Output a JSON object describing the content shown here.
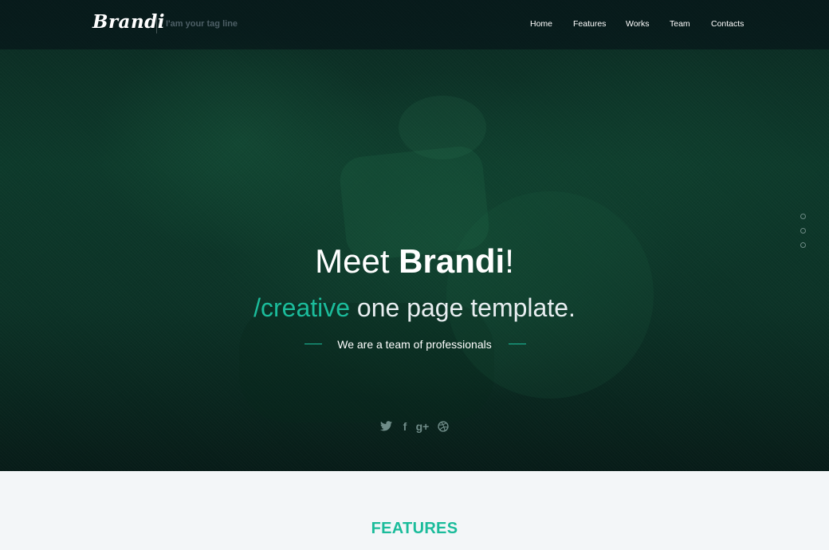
{
  "brand": {
    "logo": "Brandi",
    "tagline": "I'am your tag line"
  },
  "nav": {
    "items": [
      "Home",
      "Features",
      "Works",
      "Team",
      "Contacts"
    ]
  },
  "hero": {
    "title_prefix": "Meet ",
    "title_brand": "Brandi",
    "title_suffix": "!",
    "subtitle_accent": "/creative",
    "subtitle_rest": " one page template.",
    "note": "We are a team of professionals"
  },
  "social": {
    "icons": [
      "twitter-icon",
      "facebook-icon",
      "google-plus-icon",
      "dribbble-icon"
    ],
    "facebook_glyph": "f",
    "googleplus_glyph": "g+"
  },
  "slider": {
    "dots": 3
  },
  "features": {
    "heading": "FEATURES"
  },
  "colors": {
    "accent": "#1bbc9b",
    "hero_bg": "#0d3a2b",
    "section_bg": "#f3f6f8"
  }
}
